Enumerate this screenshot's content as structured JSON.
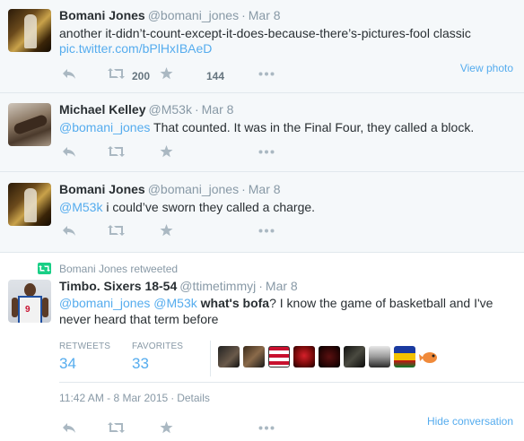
{
  "tweets": [
    {
      "name": "Bomani Jones",
      "handle": "@bomani_jones",
      "time": "Mar 8",
      "text": "another it-didn’t-count-except-it-does-because-there’s-pictures-fool classic",
      "link": "pic.twitter.com/bPlHxIBAeD",
      "retweets": "200",
      "favorites": "144",
      "view_photo": "View photo"
    },
    {
      "name": "Michael Kelley",
      "handle": "@M53k",
      "time": "Mar 8",
      "mention": "@bomani_jones",
      "text": " That counted. It was in the Final Four, they called a block."
    },
    {
      "name": "Bomani Jones",
      "handle": "@bomani_jones",
      "time": "Mar 8",
      "mention": "@M53k",
      "text": " i could’ve sworn they called a charge."
    },
    {
      "retweeted_by": "Bomani Jones retweeted",
      "name": "Timbo. Sixers 18-54",
      "handle": "@ttimetimmyj",
      "time": "Mar 8",
      "mention1": "@bomani_jones",
      "mention2": "@M53k",
      "bold_text": "what's bofa",
      "text_after_bold": "? I know the game of basketball and I've",
      "text_line2": "never heard that term before",
      "retweets_label": "RETWEETS",
      "retweets": "34",
      "favorites_label": "FAVORITES",
      "favorites": "33",
      "detail_time": "11:42 AM - 8 Mar 2015",
      "details_link": "Details",
      "avatar_jersey_number": "9",
      "hide_conversation": "Hide conversation"
    }
  ],
  "colors": {
    "link": "#55acee",
    "muted": "#8899a6",
    "text": "#292f33",
    "retweet_green": "#19cf86"
  },
  "icons": [
    "reply-icon",
    "retweet-icon",
    "favorite-icon",
    "more-icon"
  ]
}
